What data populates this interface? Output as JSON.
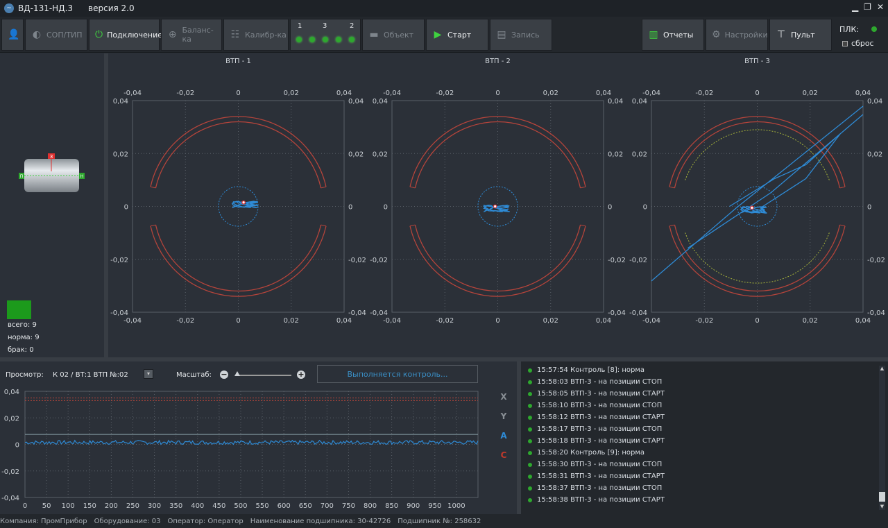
{
  "window": {
    "title": "ВД-131-НД.3",
    "version": "версия 2.0",
    "minimize": "▁",
    "restore": "❐",
    "close": "✕"
  },
  "toolbar": {
    "user_icon": "user-icon",
    "sop_tip": "СОП/ТИП",
    "connect": "Подключение",
    "balance": "Баланс-ка",
    "calib": "Калибр-ка",
    "leds_labels": [
      "1",
      "3",
      "2"
    ],
    "object": "Объект",
    "start": "Старт",
    "record": "Запись",
    "reports": "Отчеты",
    "settings": "Настройки",
    "remote": "Пульт",
    "plk": "ПЛК:",
    "reset": "сброс"
  },
  "left_panel": {
    "total": "всего: 9",
    "norm": "норма: 9",
    "defect": "брак: 0",
    "sensor_top": "З",
    "sensor_left": "П",
    "sensor_right": "Н"
  },
  "charts": {
    "titles": [
      "ВТП - 1",
      "ВТП - 2",
      "ВТП - 3"
    ],
    "ticks": [
      "-0,04",
      "-0,02",
      "0",
      "0,02",
      "0,04"
    ],
    "vticks": [
      "0,04",
      "0,02",
      "0",
      "-0,02",
      "-0,04"
    ]
  },
  "bottom": {
    "prosmotr_label": "Просмотр:",
    "prosmotr_value": "К 02 / ВТ:1  ВТП №:02",
    "masshtab_label": "Масштаб:",
    "status": "Выполняется контроль...",
    "y_ticks": [
      "0,04",
      "0,02",
      "0",
      "-0,02",
      "-0,04"
    ],
    "x_ticks": [
      "0",
      "50",
      "100",
      "150",
      "200",
      "250",
      "300",
      "350",
      "400",
      "450",
      "500",
      "550",
      "600",
      "650",
      "700",
      "750",
      "800",
      "850",
      "900",
      "950",
      "1000"
    ],
    "legend": [
      {
        "k": "X",
        "color": "#8a9096"
      },
      {
        "k": "Y",
        "color": "#8a9096"
      },
      {
        "k": "A",
        "color": "#2e8bd6"
      },
      {
        "k": "C",
        "color": "#c0392b"
      }
    ]
  },
  "log": [
    "15:57:54 Контроль [8]: норма",
    "15:58:03 ВТП-3 - на позиции СТОП",
    "15:58:05 ВТП-3 - на позиции СТАРТ",
    "15:58:10 ВТП-3 - на позиции СТОП",
    "15:58:12 ВТП-3 - на позиции СТАРТ",
    "15:58:17 ВТП-3 - на позиции СТОП",
    "15:58:18 ВТП-3 - на позиции СТАРТ",
    "15:58:20 Контроль [9]: норма",
    "15:58:30 ВТП-3 - на позиции СТОП",
    "15:58:31 ВТП-3 - на позиции СТАРТ",
    "15:58:37 ВТП-3 - на позиции СТОП",
    "15:58:38 ВТП-3 - на позиции СТАРТ"
  ],
  "statusbar": {
    "company": "Компания: ПромПрибор",
    "equipment": "Оборудование: 03",
    "operator": "Оператор: Оператор",
    "bearing_name": "Наименование подшипника: 30-42726",
    "bearing_no": "Подшипник №: 258632"
  },
  "chart_data": [
    {
      "type": "scatter",
      "title": "ВТП - 1",
      "xlim": [
        -0.04,
        0.04
      ],
      "ylim": [
        -0.04,
        0.04
      ],
      "grid": true,
      "x": [
        0.002
      ],
      "y": [
        0.0015
      ]
    },
    {
      "type": "scatter",
      "title": "ВТП - 2",
      "xlim": [
        -0.04,
        0.04
      ],
      "ylim": [
        -0.04,
        0.04
      ],
      "grid": true,
      "x": [
        -0.001
      ],
      "y": [
        0.0
      ]
    },
    {
      "type": "scatter",
      "title": "ВТП - 3",
      "xlim": [
        -0.04,
        0.04
      ],
      "ylim": [
        -0.04,
        0.04
      ],
      "grid": true,
      "x": [
        -0.002
      ],
      "y": [
        -0.0005
      ]
    },
    {
      "type": "line",
      "xlim": [
        0,
        1050
      ],
      "ylim": [
        -0.04,
        0.04
      ],
      "grid": true,
      "series": [
        {
          "name": "A",
          "values": [
            0.001
          ]
        },
        {
          "name": "C",
          "values": [
            0.035,
            0.033
          ]
        }
      ]
    }
  ]
}
